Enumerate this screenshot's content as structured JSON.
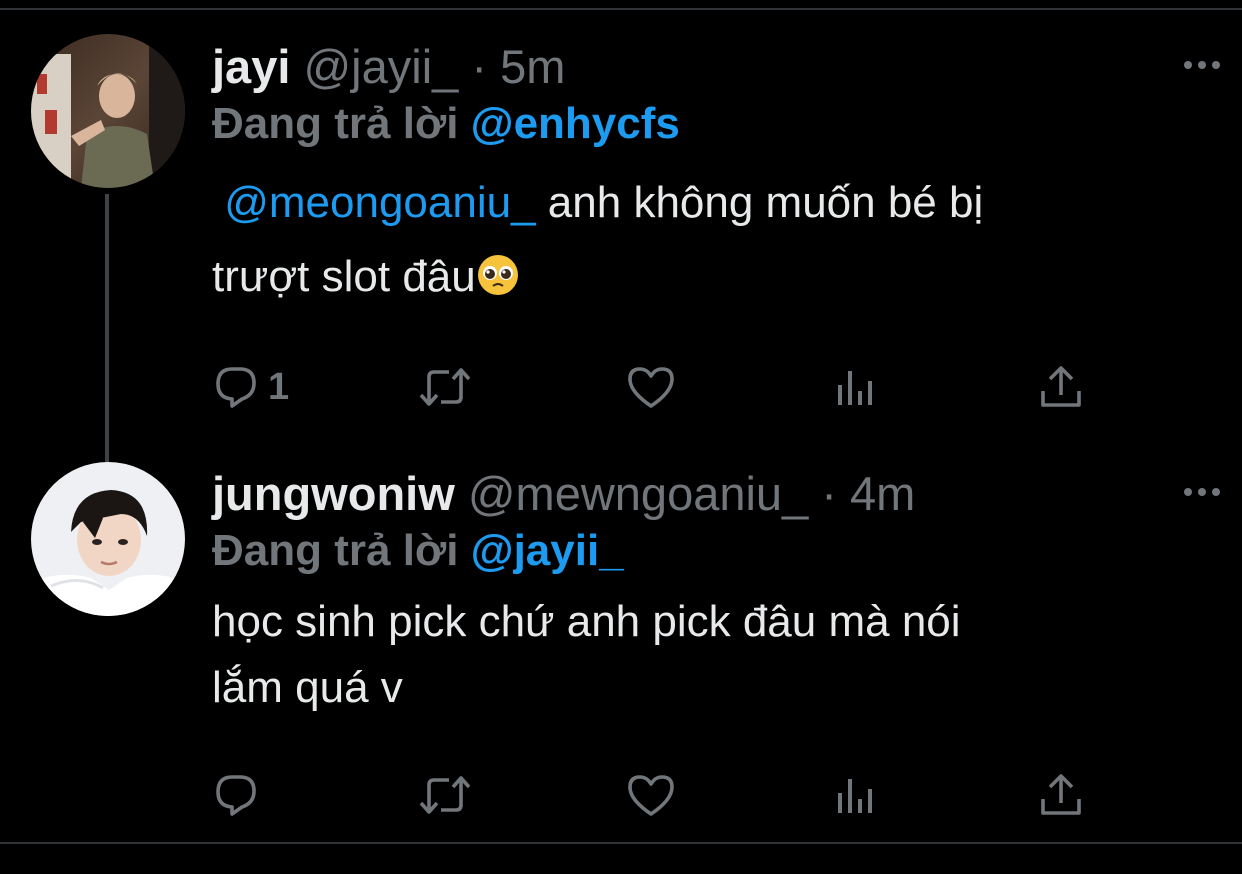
{
  "colors": {
    "background": "#000000",
    "text": "#e7e9ea",
    "muted": "#71767b",
    "link": "#1d9bf0",
    "divider": "#2f3336",
    "thread_line": "#3e4246"
  },
  "tweets": [
    {
      "name": "jayi",
      "handle": "@jayii_",
      "dot": "·",
      "time": "5m",
      "replying_prefix": "Đang trả lời",
      "replying_to": "@enhycfs",
      "mention": "@meongoaniu_",
      "text_line1": " anh không muốn bé bị",
      "text_line2": "trượt slot đâu",
      "emoji": "pleading-face-emoji",
      "reply_count": "1",
      "icons": [
        "reply-icon",
        "retweet-icon",
        "like-icon",
        "analytics-icon",
        "share-icon",
        "more-icon"
      ]
    },
    {
      "name": "jungwoniw",
      "handle": "@mewngoaniu_",
      "dot": "·",
      "time": "4m",
      "replying_prefix": "Đang trả lời",
      "replying_to": "@jayii_",
      "text_line1": "học sinh pick chứ anh pick đâu mà nói",
      "text_line2": "lắm quá v",
      "reply_count": "",
      "icons": [
        "reply-icon",
        "retweet-icon",
        "like-icon",
        "analytics-icon",
        "share-icon",
        "more-icon"
      ]
    }
  ]
}
